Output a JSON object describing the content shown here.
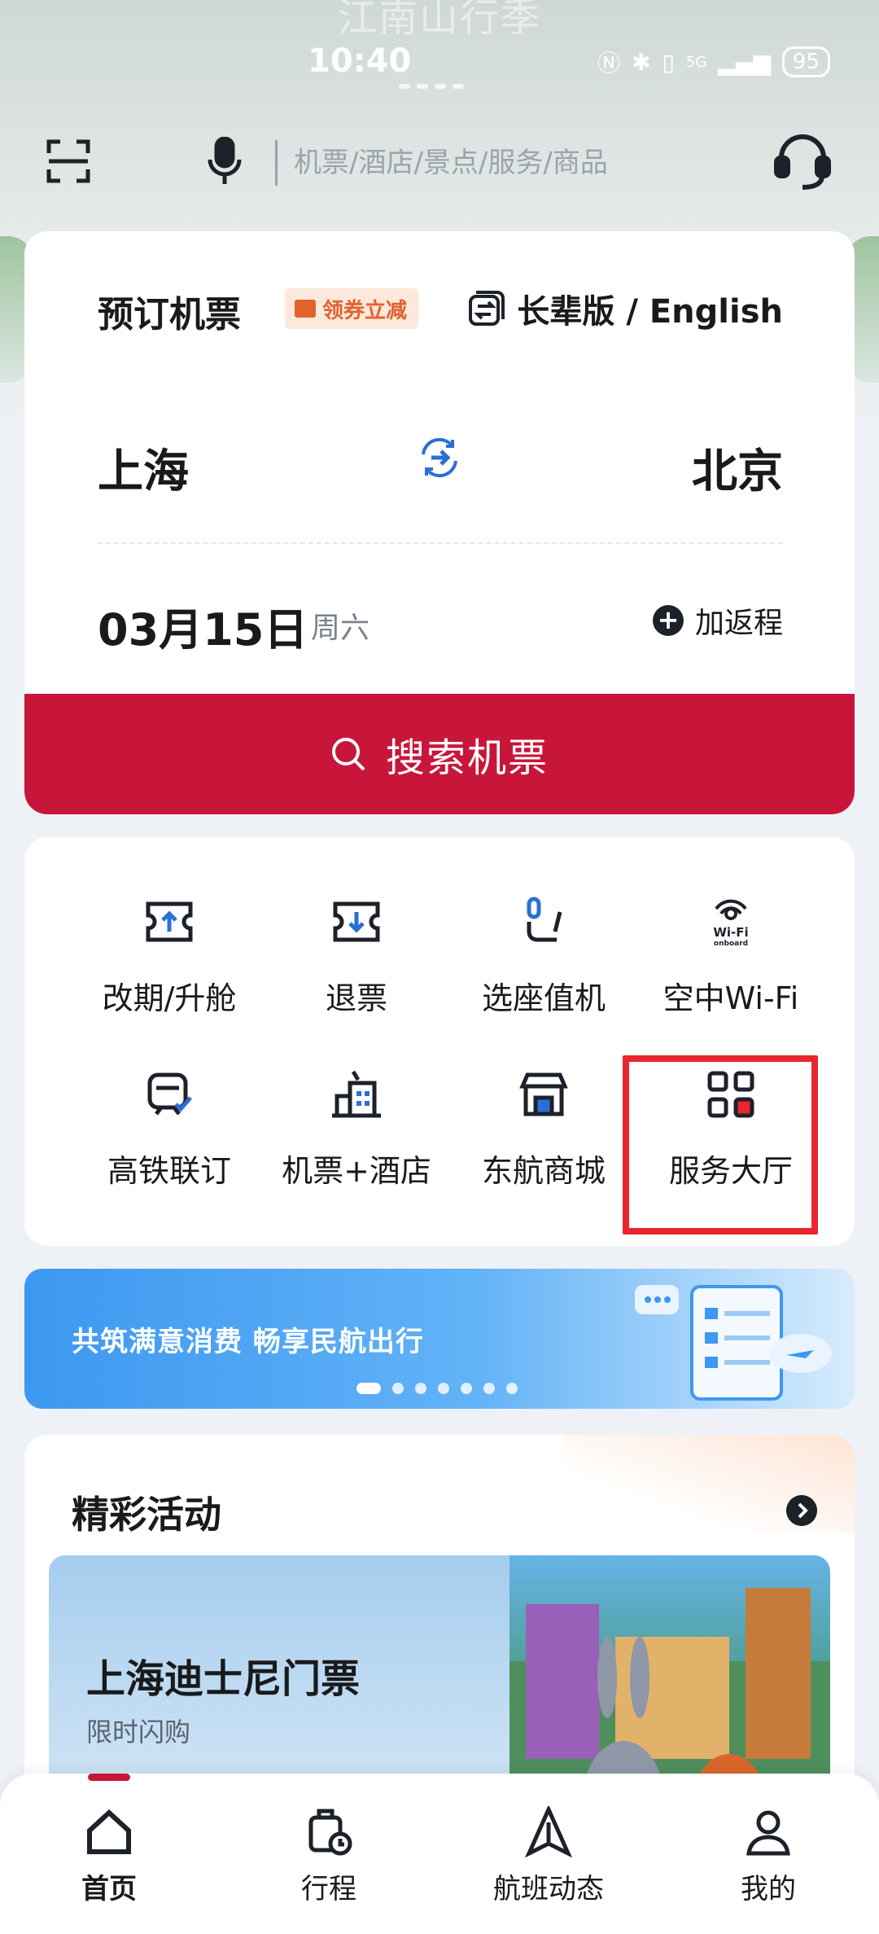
{
  "hero": {
    "banner_text": "江南山行季"
  },
  "status_bar": {
    "time": "10:40",
    "battery": "95",
    "network": "5G"
  },
  "header": {
    "search_placeholder": "机票/酒店/景点/服务/商品"
  },
  "booking": {
    "title": "预订机票",
    "coupon_label": "领券立减",
    "elder_mode_label": "长辈版 / English",
    "from_city": "上海",
    "to_city": "北京",
    "date": "03月15日",
    "weekday": "周六",
    "return_label": "加返程",
    "search_button": "搜索机票"
  },
  "services": [
    {
      "label": "改期/升舱",
      "icon": "ticket-up-icon"
    },
    {
      "label": "退票",
      "icon": "ticket-down-icon"
    },
    {
      "label": "选座值机",
      "icon": "seat-icon"
    },
    {
      "label": "空中Wi-Fi",
      "icon": "wifi-onboard-icon"
    },
    {
      "label": "高铁联订",
      "icon": "train-icon"
    },
    {
      "label": "机票+酒店",
      "icon": "hotel-icon"
    },
    {
      "label": "东航商城",
      "icon": "store-icon"
    },
    {
      "label": "服务大厅",
      "icon": "grid-icon"
    }
  ],
  "wifi_badge": {
    "line1": "Wi-Fi",
    "line2": "onboard"
  },
  "promo_banner": {
    "text": "共筑满意消费 畅享民航出行",
    "page_count": 7,
    "active_page": 1
  },
  "activities": {
    "title": "精彩活动",
    "item_name": "上海迪士尼门票",
    "item_subtitle": "限时闪购"
  },
  "tabbar": [
    {
      "label": "首页",
      "icon": "home-icon",
      "active": true
    },
    {
      "label": "行程",
      "icon": "trip-icon",
      "active": false
    },
    {
      "label": "航班动态",
      "icon": "flight-status-icon",
      "active": false
    },
    {
      "label": "我的",
      "icon": "profile-icon",
      "active": false
    }
  ],
  "colors": {
    "brand_red": "#c8163a",
    "highlight_red": "#e8262c",
    "accent_blue": "#2a6fd6"
  }
}
